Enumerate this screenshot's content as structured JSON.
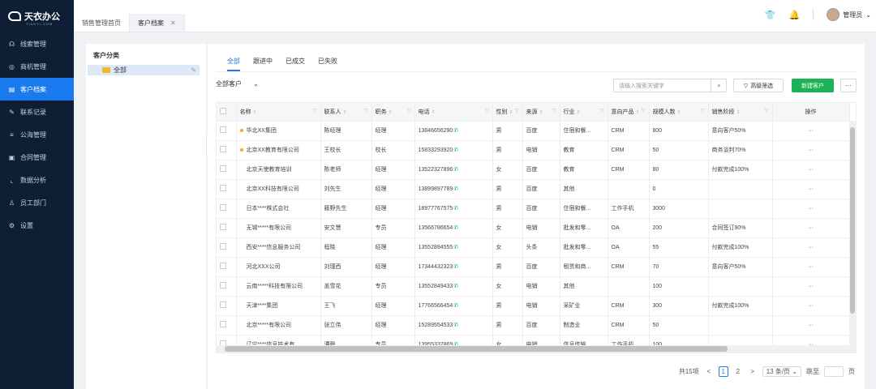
{
  "sidebar": {
    "logo": "天衣办公",
    "logo_sub": "TIANYI.COM",
    "items": [
      {
        "label": "线索管理",
        "icon": "☊"
      },
      {
        "label": "商机管理",
        "icon": "◎"
      },
      {
        "label": "客户档案",
        "icon": "▤"
      },
      {
        "label": "联系记录",
        "icon": "✎"
      },
      {
        "label": "公海管理",
        "icon": "≡"
      },
      {
        "label": "合同管理",
        "icon": "▣"
      },
      {
        "label": "数据分析",
        "icon": "⌞"
      },
      {
        "label": "员工部门",
        "icon": "♙"
      },
      {
        "label": "设置",
        "icon": "⚙"
      }
    ]
  },
  "topbar": {
    "tabs": [
      {
        "label": "销售管理首页"
      },
      {
        "label": "客户档案"
      }
    ],
    "user": "管理员"
  },
  "leftpanel": {
    "title": "客户分类",
    "item": "全部"
  },
  "main": {
    "subtabs": [
      "全部",
      "跟进中",
      "已成交",
      "已失败"
    ],
    "filter_label": "全部客户",
    "search_placeholder": "请输入搜索关键字",
    "adv_filter": "高级筛选",
    "new_button": "新建客户",
    "more_button": "···"
  },
  "table": {
    "headers": [
      "名称",
      "联系人",
      "职务",
      "电话",
      "性别",
      "来源",
      "行业",
      "意向产品",
      "规模人数",
      "销售阶段",
      "操作"
    ],
    "rows": [
      {
        "dot": true,
        "name": "华北XX集团",
        "contact": "陈经理",
        "title": "经理",
        "phone": "13846656290",
        "gender": "男",
        "source": "百度",
        "industry": "住宿和餐...",
        "product": "CRM",
        "size": "800",
        "stage": "意向客户50%"
      },
      {
        "dot": true,
        "name": "北京XX教育有限公司",
        "contact": "王校长",
        "title": "校长",
        "phone": "15833293920",
        "gender": "男",
        "source": "电销",
        "industry": "教育",
        "product": "CRM",
        "size": "50",
        "stage": "商务谈判70%"
      },
      {
        "dot": false,
        "name": "北京天使教育培训",
        "contact": "陈老师",
        "title": "经理",
        "phone": "13522327896",
        "gender": "女",
        "source": "百度",
        "industry": "教育",
        "product": "CRM",
        "size": "80",
        "stage": "付款完成100%"
      },
      {
        "dot": false,
        "name": "北京XX科技有限公司",
        "contact": "刘先生",
        "title": "经理",
        "phone": "13899897789",
        "gender": "男",
        "source": "百度",
        "industry": "其他",
        "product": "",
        "size": "0",
        "stage": ""
      },
      {
        "dot": false,
        "name": "日本****株式会社",
        "contact": "藤野先生",
        "title": "经理",
        "phone": "18977767575",
        "gender": "男",
        "source": "百度",
        "industry": "住宿和餐...",
        "product": "工作手机",
        "size": "3000",
        "stage": ""
      },
      {
        "dot": false,
        "name": "无锡*****有限公司",
        "contact": "安文慧",
        "title": "专员",
        "phone": "13566786654",
        "gender": "女",
        "source": "电销",
        "industry": "批发和零...",
        "product": "OA",
        "size": "200",
        "stage": "合同签订90%"
      },
      {
        "dot": false,
        "name": "西安****信息服务公司",
        "contact": "程晓",
        "title": "经理",
        "phone": "13552894555",
        "gender": "女",
        "source": "头条",
        "industry": "批发和零...",
        "product": "OA",
        "size": "55",
        "stage": "付款完成100%"
      },
      {
        "dot": false,
        "name": "河北XXX公司",
        "contact": "刘瑾西",
        "title": "经理",
        "phone": "17344432323",
        "gender": "男",
        "source": "百度",
        "industry": "租赁和商...",
        "product": "CRM",
        "size": "70",
        "stage": "意向客户50%"
      },
      {
        "dot": false,
        "name": "云南*****科技有限公司",
        "contact": "盖雪花",
        "title": "专员",
        "phone": "13552849433",
        "gender": "女",
        "source": "电销",
        "industry": "其他",
        "product": "",
        "size": "100",
        "stage": ""
      },
      {
        "dot": false,
        "name": "天津****集团",
        "contact": "王飞",
        "title": "经理",
        "phone": "17766566454",
        "gender": "男",
        "source": "电销",
        "industry": "采矿业",
        "product": "CRM",
        "size": "300",
        "stage": "付款完成100%"
      },
      {
        "dot": false,
        "name": "北京*****有限公司",
        "contact": "张立伟",
        "title": "经理",
        "phone": "15289554533",
        "gender": "男",
        "source": "百度",
        "industry": "制造业",
        "product": "CRM",
        "size": "50",
        "stage": ""
      },
      {
        "dot": false,
        "name": "辽宁****信息技术有",
        "contact": "谭磬",
        "title": "专员",
        "phone": "13955337869",
        "gender": "女",
        "source": "电销",
        "industry": "信息传输...",
        "product": "工作手机",
        "size": "100",
        "stage": ""
      }
    ],
    "op": "···"
  },
  "pager": {
    "total": "共15项",
    "prev": "<",
    "pages": [
      "1",
      "2"
    ],
    "next": ">",
    "size": "13 条/页",
    "goto": "跳至",
    "page_unit": "页"
  }
}
